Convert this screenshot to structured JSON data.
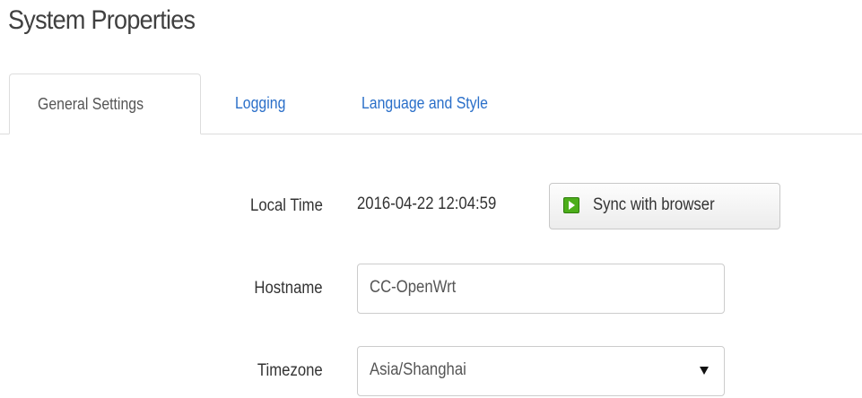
{
  "page": {
    "title": "System Properties"
  },
  "tabs": [
    {
      "label": "General Settings",
      "active": true
    },
    {
      "label": "Logging",
      "active": false
    },
    {
      "label": "Language and Style",
      "active": false
    }
  ],
  "form": {
    "local_time": {
      "label": "Local Time",
      "value": "2016-04-22 12:04:59",
      "sync_button_label": "Sync with browser",
      "sync_icon": "play-icon"
    },
    "hostname": {
      "label": "Hostname",
      "value": "CC-OpenWrt"
    },
    "timezone": {
      "label": "Timezone",
      "selected": "Asia/Shanghai"
    }
  },
  "colors": {
    "link": "#2a6fc9",
    "sync_icon": "#4cae1a",
    "border": "#dddddd"
  }
}
